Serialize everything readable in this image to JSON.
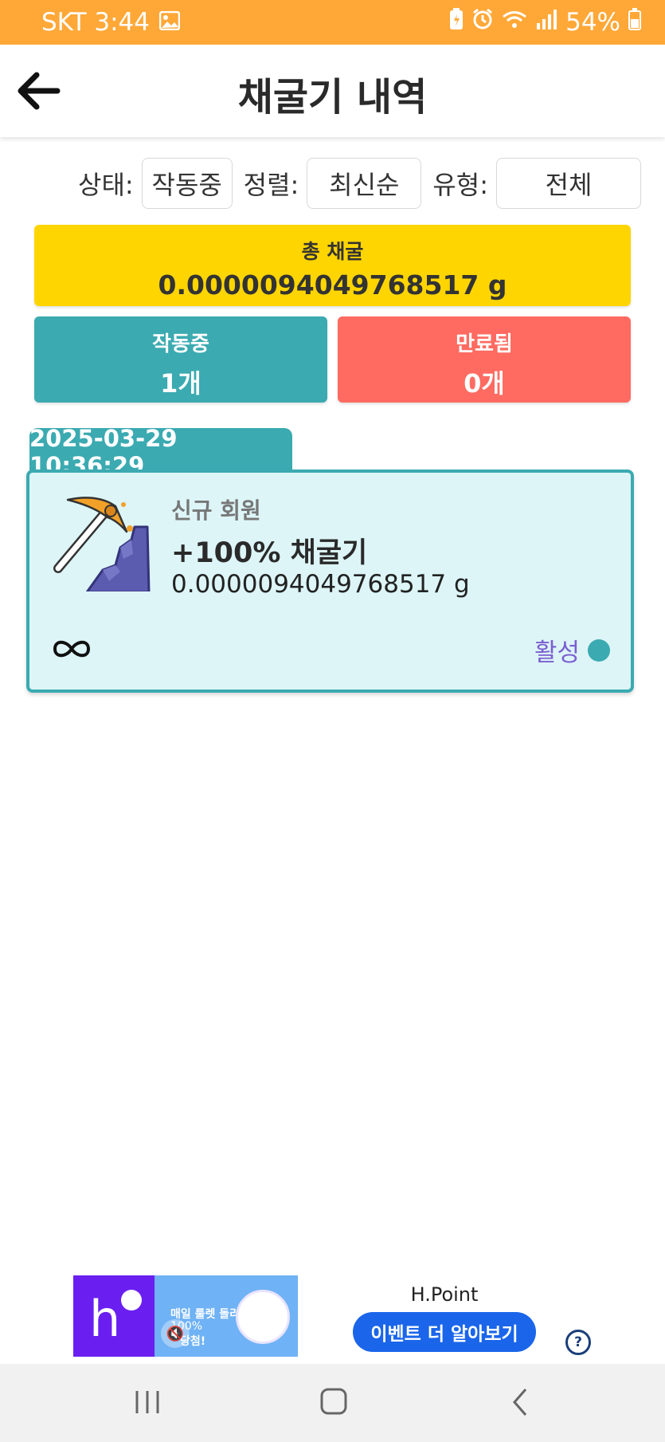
{
  "status_bar": {
    "carrier_time": "SKT 3:44",
    "battery": "54%",
    "icons": [
      "gallery-icon",
      "battery-saver-icon",
      "alarm-icon",
      "wifi-icon",
      "signal-icon",
      "battery-icon"
    ]
  },
  "header": {
    "title": "채굴기 내역",
    "back_icon": "arrow-left-icon"
  },
  "filters": {
    "status_label": "상태:",
    "status_value": "작동중",
    "sort_label": "정렬:",
    "sort_value": "최신순",
    "type_label": "유형:",
    "type_value": "전체"
  },
  "summary": {
    "total_label": "총 채굴",
    "total_value": "0.0000094049768517 g",
    "active_label": "작동중",
    "active_count": "1개",
    "expired_label": "만료됨",
    "expired_count": "0개"
  },
  "miners": [
    {
      "date": "2025-03-29 10:36:29",
      "category": "신규 회원",
      "name": "+100% 채굴기",
      "amount": "0.0000094049768517 g",
      "duration_icon": "infinity-icon",
      "status": "활성"
    }
  ],
  "ad": {
    "title": "H.Point",
    "button": "이벤트 더 알아보기",
    "banner_line1": "매일 룰렛 돌리면",
    "banner_line2": "100%",
    "banner_line3": "당첨!"
  },
  "colors": {
    "status_bar": "#FFA838",
    "teal": "#3BAAB1",
    "yellow": "#FFD500",
    "coral": "#FF6B61",
    "purple": "#7B5FD0",
    "ad_blue": "#1A65EA"
  }
}
